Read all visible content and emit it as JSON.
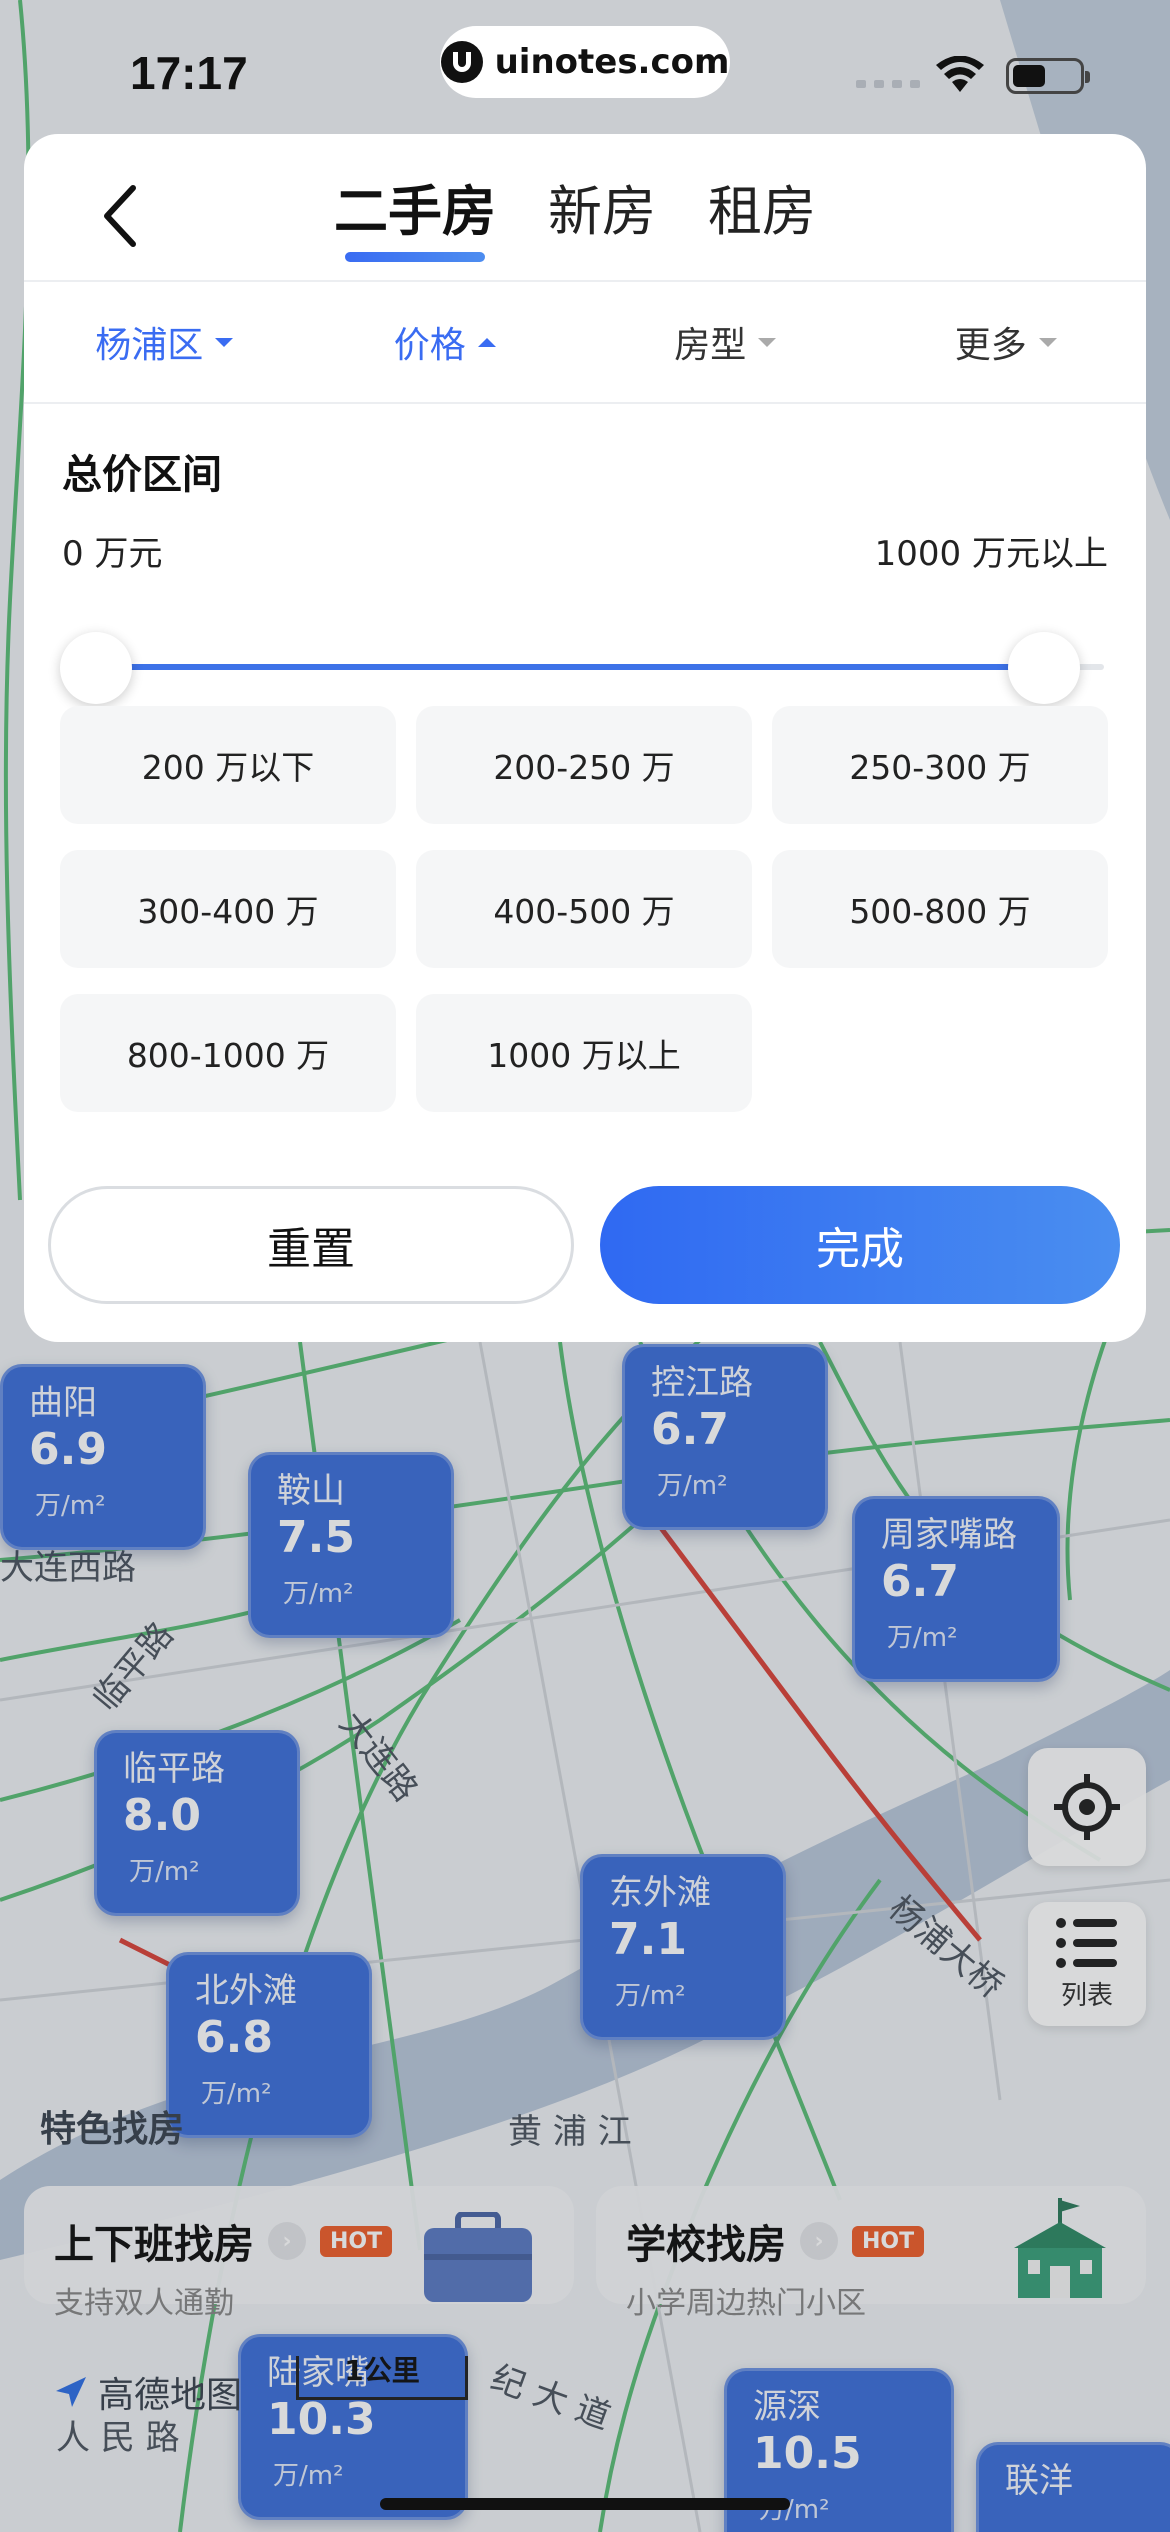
{
  "status_bar": {
    "time": "17:17",
    "site": "uinotes.com"
  },
  "tabs": [
    {
      "label": "二手房",
      "active": true
    },
    {
      "label": "新房",
      "active": false
    },
    {
      "label": "租房",
      "active": false
    }
  ],
  "filters": [
    {
      "label": "杨浦区",
      "active": true,
      "caret": "down"
    },
    {
      "label": "价格",
      "active": true,
      "caret": "up"
    },
    {
      "label": "房型",
      "active": false,
      "caret": "down"
    },
    {
      "label": "更多",
      "active": false,
      "caret": "down"
    }
  ],
  "price_panel": {
    "title": "总价区间",
    "min_label": "0 万元",
    "max_label": "1000 万元以上",
    "range_selected_fraction": [
      0,
      1
    ],
    "options": [
      "200 万以下",
      "200-250 万",
      "250-300 万",
      "300-400 万",
      "400-500 万",
      "500-800 万",
      "800-1000 万",
      "1000 万以上"
    ],
    "reset_label": "重置",
    "done_label": "完成"
  },
  "map": {
    "bubbles": [
      {
        "name": "曲阳",
        "price": "6.9",
        "unit": "万/m²"
      },
      {
        "name": "鞍山",
        "price": "7.5",
        "unit": "万/m²"
      },
      {
        "name": "控江路",
        "price": "6.7",
        "unit": "万/m²"
      },
      {
        "name": "周家嘴路",
        "price": "6.7",
        "unit": "万/m²"
      },
      {
        "name": "临平路",
        "price": "8.0",
        "unit": "万/m²"
      },
      {
        "name": "东外滩",
        "price": "7.1",
        "unit": "万/m²"
      },
      {
        "name": "北外滩",
        "price": "6.8",
        "unit": "万/m²"
      },
      {
        "name": "陆家嘴",
        "price": "10.3",
        "unit": "万/m²"
      },
      {
        "name": "源深",
        "price": "10.5",
        "unit": "万/m²"
      },
      {
        "name": "联洋",
        "price": "",
        "unit": ""
      }
    ],
    "labels": [
      "大连西路",
      "大连路",
      "临平路",
      "杨浦大桥",
      "黄 浦 江",
      "纪 大 道",
      "人 民 路"
    ],
    "locate_icon": "crosshair-icon",
    "list_label": "列表",
    "feature_title": "特色找房",
    "cards": [
      {
        "title": "上下班找房",
        "badge": "HOT",
        "subtitle": "支持双人通勤"
      },
      {
        "title": "学校找房",
        "badge": "HOT",
        "subtitle": "小学周边热门小区"
      }
    ],
    "provider": "高德地图",
    "scale": "1公里"
  },
  "colors": {
    "accent": "#3a6cf2",
    "bubble": "#3d6fd9",
    "hot": "#ee5e2b"
  }
}
